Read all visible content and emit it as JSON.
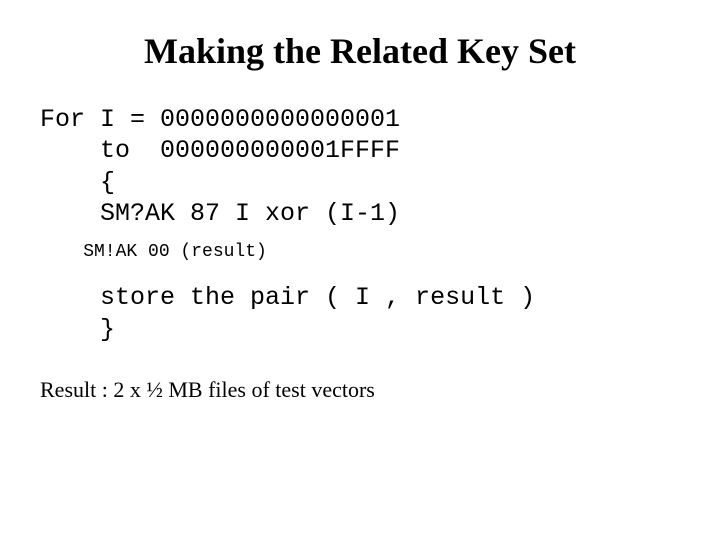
{
  "title": "Making the Related Key Set",
  "code": {
    "line1": "For I = 0000000000000001",
    "line2": "    to  000000000001FFFF",
    "line3": "    {",
    "line4": "    SM?AK 87 I xor (I-1)",
    "line5": "    SM!AK 00 (result)",
    "line6": "    store the pair ( I , result )",
    "line7": "    }"
  },
  "result": "Result : 2 x ½ MB files of test vectors"
}
